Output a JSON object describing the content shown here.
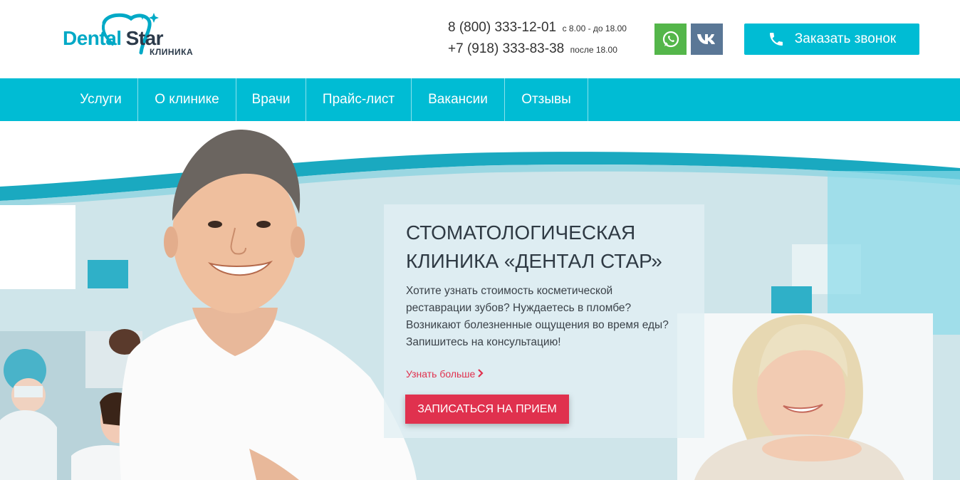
{
  "brand": {
    "name_part1": "Dental",
    "name_part2": "Star",
    "subtitle": "КЛИНИКА"
  },
  "contacts": {
    "phone1": "8 (800) 333-12-01",
    "phone1_note": "с 8.00 - до 18.00",
    "phone2": "+7 (918) 333-83-38",
    "phone2_note": "после 18.00"
  },
  "social": {
    "whatsapp_icon": "whatsapp-icon",
    "vk_icon": "vk-icon"
  },
  "callback_button": {
    "label": "Заказать звонок",
    "icon": "phone-icon"
  },
  "nav": {
    "items": [
      {
        "label": "Услуги"
      },
      {
        "label": "О клинике"
      },
      {
        "label": "Врачи"
      },
      {
        "label": "Прайс-лист"
      },
      {
        "label": "Вакансии"
      },
      {
        "label": "Отзывы"
      }
    ]
  },
  "hero": {
    "title_line1": "СТОМАТОЛОГИЧЕСКАЯ",
    "title_line2": "КЛИНИКА «ДЕНТАЛ СТАР»",
    "text_line1": "Хотите узнать стоимость косметической",
    "text_line2": "реставрации зубов? Нуждаетесь в пломбе?",
    "text_line3": "Возникают болезненные ощущения во время еды?",
    "text_line4": "Запишитесь на консультацию!",
    "more_link": "Узнать больше",
    "cta_button": "ЗАПИСАТЬСЯ НА ПРИЕМ"
  },
  "colors": {
    "accent": "#00bcd4",
    "cta": "#e0314e",
    "whatsapp": "#54b64a",
    "vk": "#5a7796",
    "text_dark": "#2f3a44"
  }
}
